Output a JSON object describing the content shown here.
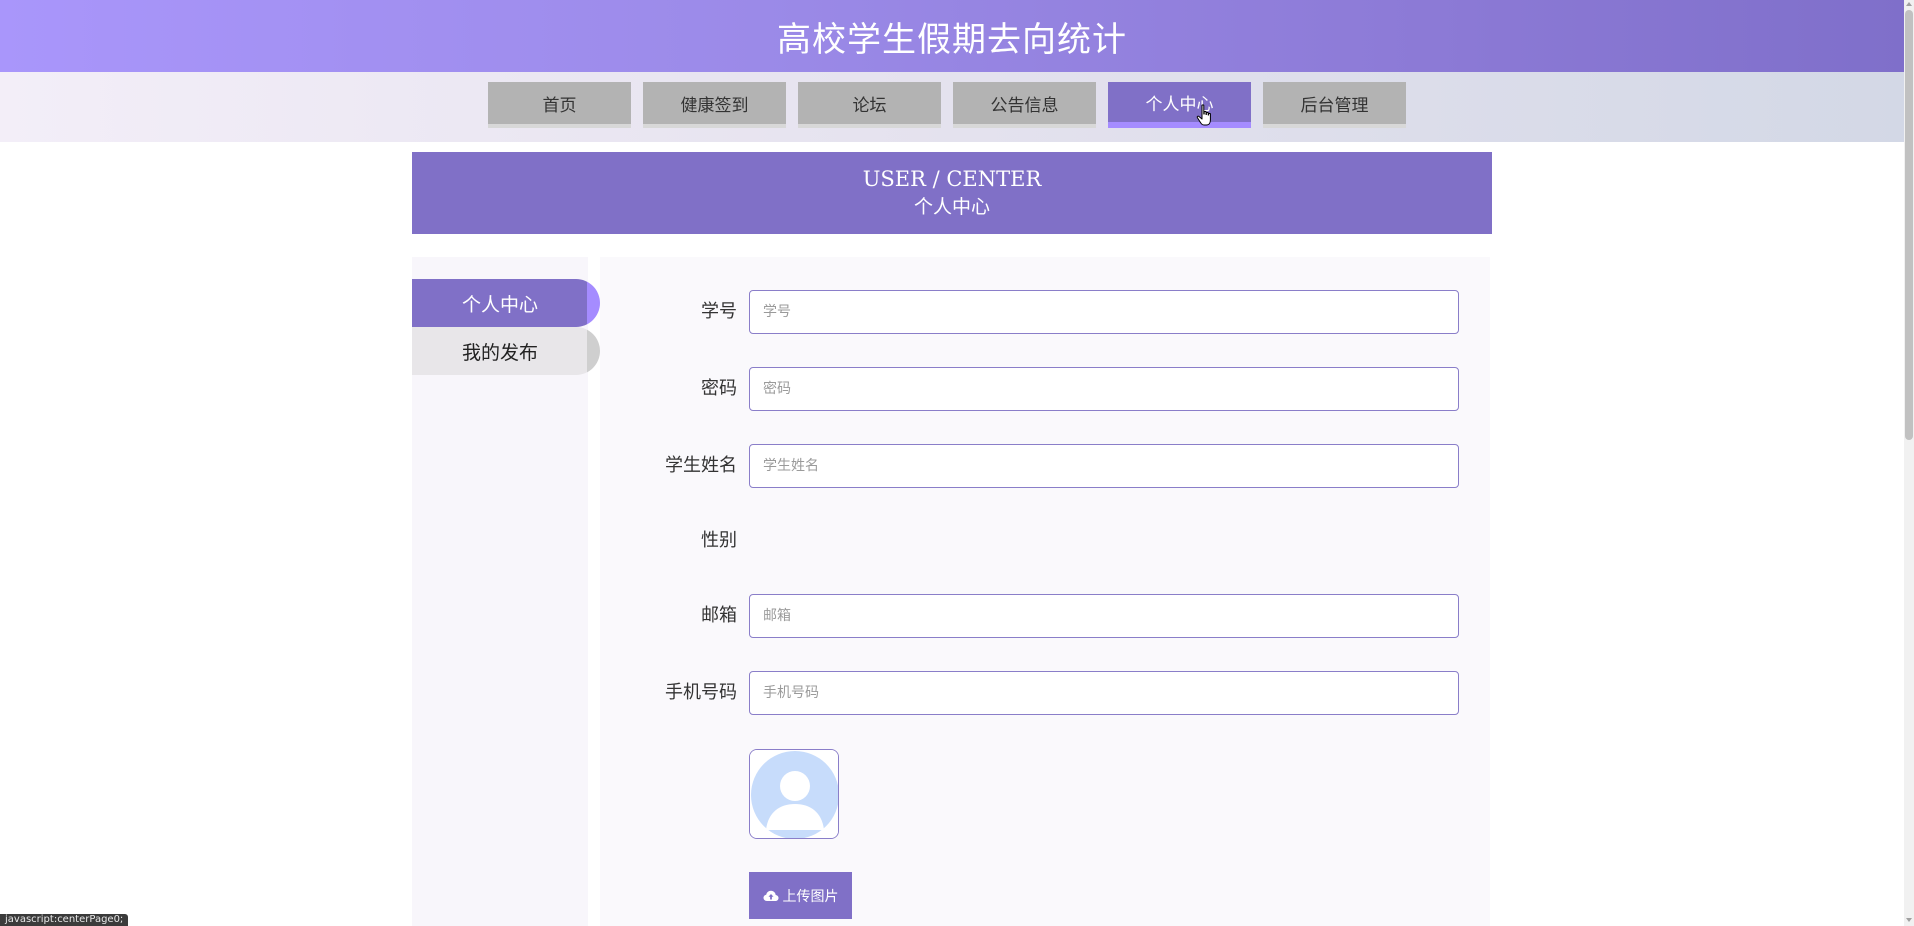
{
  "header": {
    "title": "高校学生假期去向统计"
  },
  "nav": {
    "items": [
      {
        "label": "首页",
        "active": false
      },
      {
        "label": "健康签到",
        "active": false
      },
      {
        "label": "论坛",
        "active": false
      },
      {
        "label": "公告信息",
        "active": false
      },
      {
        "label": "个人中心",
        "active": true
      },
      {
        "label": "后台管理",
        "active": false
      }
    ]
  },
  "banner": {
    "title_en": "USER / CENTER",
    "title_cn": "个人中心"
  },
  "sidebar": {
    "items": [
      {
        "label": "个人中心",
        "active": true
      },
      {
        "label": "我的发布",
        "active": false
      }
    ]
  },
  "form": {
    "student_id": {
      "label": "学号",
      "placeholder": "学号",
      "value": ""
    },
    "password": {
      "label": "密码",
      "placeholder": "密码",
      "value": ""
    },
    "student_name": {
      "label": "学生姓名",
      "placeholder": "学生姓名",
      "value": ""
    },
    "gender": {
      "label": "性别"
    },
    "email": {
      "label": "邮箱",
      "placeholder": "邮箱",
      "value": ""
    },
    "phone": {
      "label": "手机号码",
      "placeholder": "手机号码",
      "value": ""
    },
    "upload_label": "上传图片"
  },
  "status_bar": {
    "text": "javascript:centerPage0;"
  },
  "colors": {
    "accent": "#8070c7",
    "accent_light": "#a58cff",
    "nav_inactive": "#b3b3b3"
  },
  "icons": {
    "upload": "cloud-upload-icon",
    "avatar": "user-avatar-placeholder-icon",
    "cursor": "hand-pointer-cursor"
  }
}
